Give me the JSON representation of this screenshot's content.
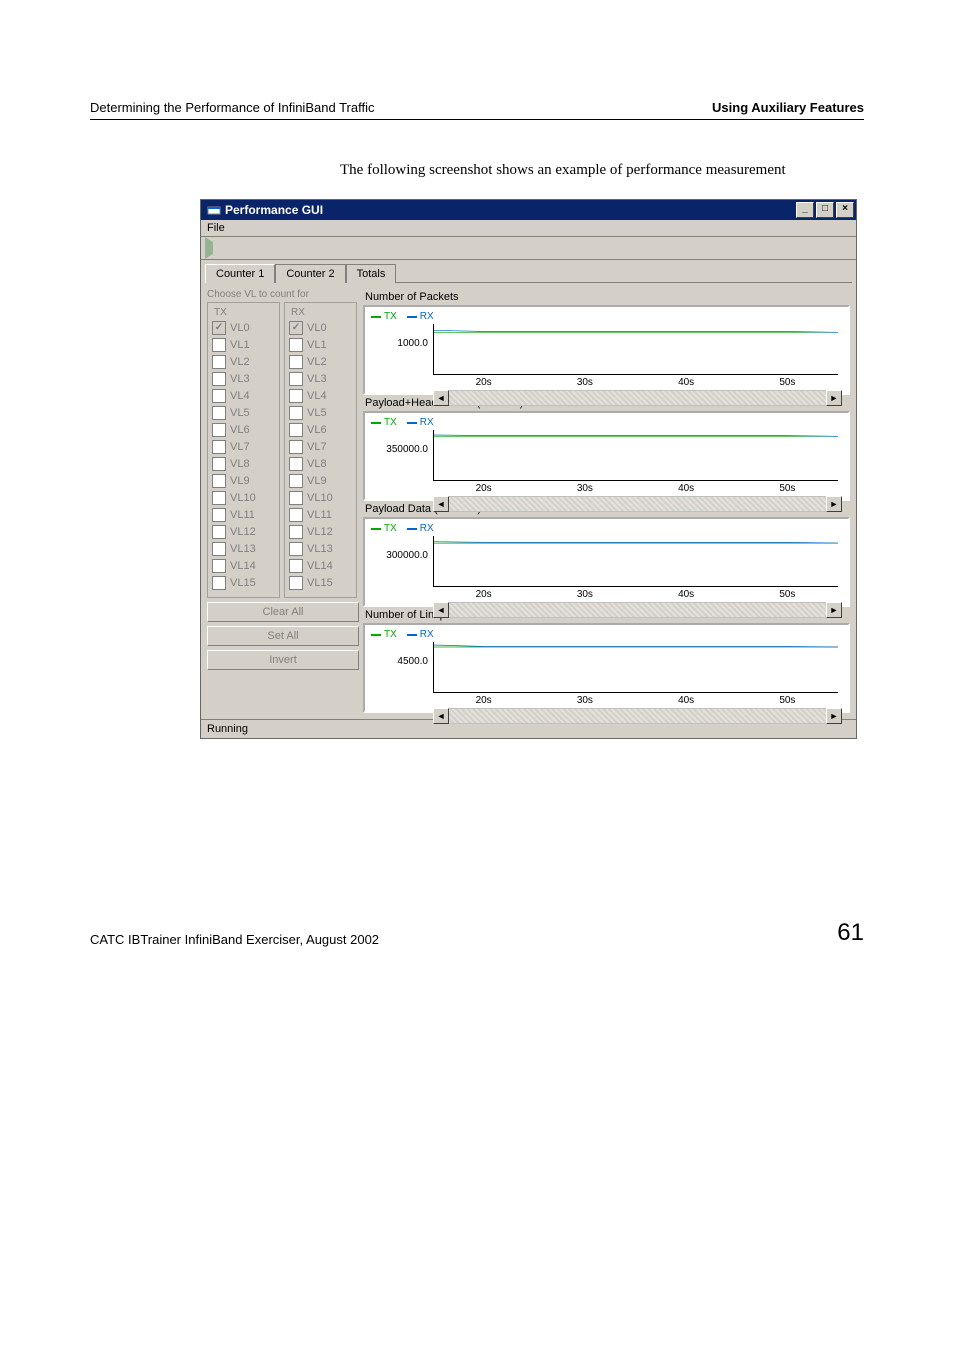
{
  "header": {
    "left": "Determining the Performance of InfiniBand Traffic",
    "right": "Using Auxiliary Features"
  },
  "intro": "The following screenshot shows an example of performance measurement",
  "window": {
    "title": "Performance GUI",
    "menu_file": "File",
    "tabs": [
      "Counter 1",
      "Counter 2",
      "Totals"
    ],
    "choose_label": "Choose VL to count for",
    "tx_legend_title": "TX",
    "rx_legend_title": "RX",
    "vl_labels": [
      "VL0",
      "VL1",
      "VL2",
      "VL3",
      "VL4",
      "VL5",
      "VL6",
      "VL7",
      "VL8",
      "VL9",
      "VL10",
      "VL11",
      "VL12",
      "VL13",
      "VL14",
      "VL15"
    ],
    "tx_checked": [
      true,
      false,
      false,
      false,
      false,
      false,
      false,
      false,
      false,
      false,
      false,
      false,
      false,
      false,
      false,
      false
    ],
    "rx_checked": [
      true,
      false,
      false,
      false,
      false,
      false,
      false,
      false,
      false,
      false,
      false,
      false,
      false,
      false,
      false,
      false
    ],
    "buttons": {
      "clear_all": "Clear All",
      "set_all": "Set All",
      "invert": "Invert"
    },
    "legend": {
      "tx": "TX",
      "rx": "RX"
    },
    "colors": {
      "tx": "#00aa00",
      "rx": "#0066cc"
    },
    "charts": [
      {
        "title": "Number of Packets",
        "yvalue": "1000.0",
        "xticks": [
          "20s",
          "30s",
          "40s",
          "50s"
        ]
      },
      {
        "title": "Payload+Header Data (DWords)",
        "yvalue": "350000.0",
        "xticks": [
          "20s",
          "30s",
          "40s",
          "50s"
        ]
      },
      {
        "title": "Payload Data (DWords)",
        "yvalue": "300000.0",
        "xticks": [
          "20s",
          "30s",
          "40s",
          "50s"
        ]
      },
      {
        "title": "Number of Linkpackets",
        "yvalue": "4500.0",
        "xticks": [
          "20s",
          "30s",
          "40s",
          "50s"
        ]
      }
    ],
    "status": "Running"
  },
  "footer": {
    "left": "CATC IBTrainer InfiniBand Exerciser, August 2002",
    "page": "61"
  },
  "chart_data": [
    {
      "type": "line",
      "title": "Number of Packets",
      "xlabel": "",
      "ylabel": "",
      "x": [
        15,
        20,
        25,
        30,
        35,
        40,
        45,
        50,
        55
      ],
      "series": [
        {
          "name": "TX",
          "values": [
            1000,
            1000,
            1000,
            1000,
            1000,
            1000,
            1000,
            1000,
            1000
          ]
        },
        {
          "name": "RX",
          "values": [
            1050,
            1020,
            1020,
            1020,
            1020,
            1020,
            1020,
            1020,
            1000
          ]
        }
      ],
      "ylim": [
        0,
        1200
      ]
    },
    {
      "type": "line",
      "title": "Payload+Header Data (DWords)",
      "xlabel": "",
      "ylabel": "",
      "x": [
        15,
        20,
        25,
        30,
        35,
        40,
        45,
        50,
        55
      ],
      "series": [
        {
          "name": "TX",
          "values": [
            350000,
            350000,
            350000,
            350000,
            350000,
            350000,
            350000,
            350000,
            350000
          ]
        },
        {
          "name": "RX",
          "values": [
            360000,
            355000,
            355000,
            355000,
            355000,
            355000,
            355000,
            355000,
            350000
          ]
        }
      ],
      "ylim": [
        0,
        400000
      ]
    },
    {
      "type": "line",
      "title": "Payload Data (DWords)",
      "xlabel": "",
      "ylabel": "",
      "x": [
        15,
        20,
        25,
        30,
        35,
        40,
        45,
        50,
        55
      ],
      "series": [
        {
          "name": "TX",
          "values": [
            300000,
            300000,
            300000,
            300000,
            300000,
            300000,
            300000,
            300000,
            300000
          ]
        },
        {
          "name": "RX",
          "values": [
            310000,
            305000,
            305000,
            305000,
            305000,
            305000,
            305000,
            305000,
            300000
          ]
        }
      ],
      "ylim": [
        0,
        350000
      ]
    },
    {
      "type": "line",
      "title": "Number of Linkpackets",
      "xlabel": "",
      "ylabel": "",
      "x": [
        15,
        20,
        25,
        30,
        35,
        40,
        45,
        50,
        55
      ],
      "series": [
        {
          "name": "TX",
          "values": [
            4500,
            4500,
            4500,
            4500,
            4500,
            4500,
            4500,
            4500,
            4500
          ]
        },
        {
          "name": "RX",
          "values": [
            4700,
            4550,
            4550,
            4550,
            4550,
            4550,
            4550,
            4550,
            4500
          ]
        }
      ],
      "ylim": [
        0,
        5000
      ]
    }
  ]
}
